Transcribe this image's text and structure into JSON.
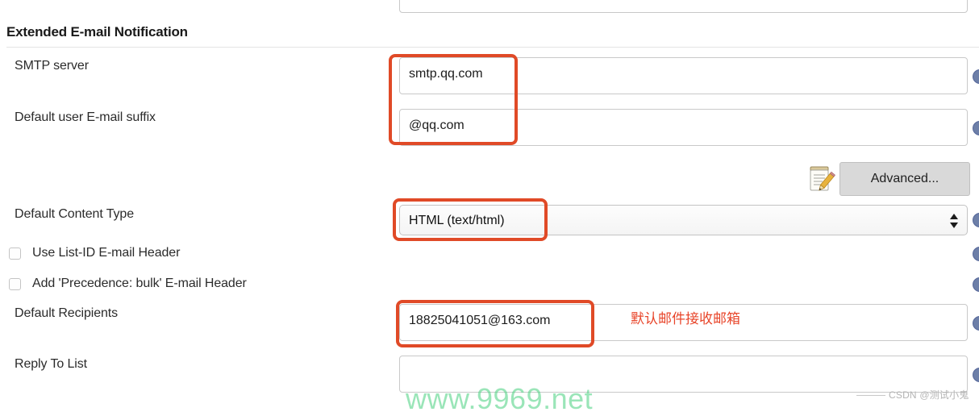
{
  "section": {
    "heading": "Extended E-mail Notification"
  },
  "top_partial_field": {
    "value": ""
  },
  "fields": {
    "smtp_server": {
      "label": "SMTP server",
      "value": "smtp.qq.com",
      "placeholder": ""
    },
    "email_suffix": {
      "label": "Default user E-mail suffix",
      "value": "@qq.com",
      "placeholder": ""
    },
    "content_type": {
      "label": "Default Content Type",
      "value": "HTML (text/html)"
    },
    "default_recipients": {
      "label": "Default Recipients",
      "value": "18825041051@163.com",
      "placeholder": ""
    },
    "reply_to_list": {
      "label": "Reply To List",
      "value": "",
      "placeholder": ""
    }
  },
  "checkboxes": [
    {
      "label": "Use List-ID E-mail Header",
      "checked": false
    },
    {
      "label": "Add 'Precedence: bulk' E-mail Header",
      "checked": false
    }
  ],
  "toolbar": {
    "advanced_label": "Advanced...",
    "notepad_icon": "notepad-pencil-icon"
  },
  "annotations": {
    "highlight_color": "#e04a27",
    "recipients_note": "默认邮件接收邮箱"
  },
  "watermarks": {
    "site": "www.9969.net",
    "csdn": "CSDN @测试小鬼"
  },
  "help_icon": {
    "name": "help-circle-icon",
    "color": "#6d7fa8"
  }
}
